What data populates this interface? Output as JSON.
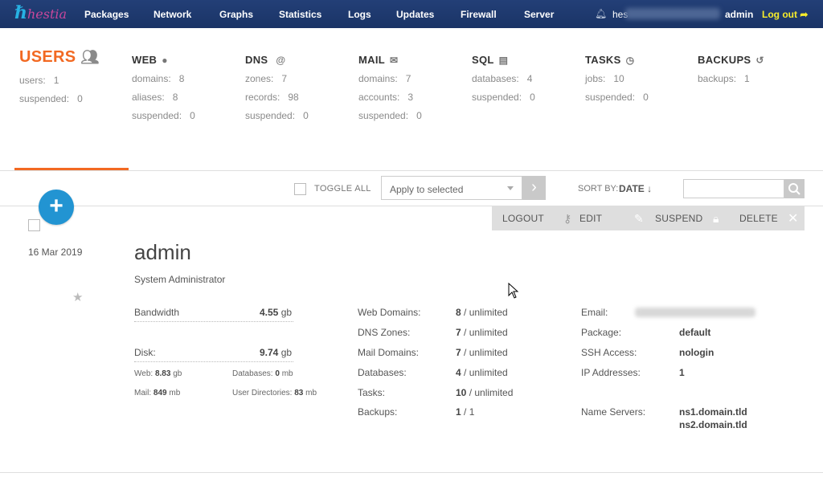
{
  "nav": {
    "logo": "hestia",
    "items": [
      "Packages",
      "Network",
      "Graphs",
      "Statistics",
      "Logs",
      "Updates",
      "Firewall",
      "Server"
    ],
    "user_prefix": "hes",
    "admin": "admin",
    "logout": "Log out"
  },
  "stats": {
    "users": {
      "title": "USERS",
      "rows": [
        [
          "users:",
          "1"
        ],
        [
          "suspended:",
          "0"
        ]
      ]
    },
    "web": {
      "title": "WEB",
      "rows": [
        [
          "domains:",
          "8"
        ],
        [
          "aliases:",
          "8"
        ],
        [
          "suspended:",
          "0"
        ]
      ]
    },
    "dns": {
      "title": "DNS",
      "rows": [
        [
          "zones:",
          "7"
        ],
        [
          "records:",
          "98"
        ],
        [
          "suspended:",
          "0"
        ]
      ]
    },
    "mail": {
      "title": "MAIL",
      "rows": [
        [
          "domains:",
          "7"
        ],
        [
          "accounts:",
          "3"
        ],
        [
          "suspended:",
          "0"
        ]
      ]
    },
    "sql": {
      "title": "SQL",
      "rows": [
        [
          "databases:",
          "4"
        ],
        [
          "suspended:",
          "0"
        ]
      ]
    },
    "tasks": {
      "title": "TASKS",
      "rows": [
        [
          "jobs:",
          "10"
        ],
        [
          "suspended:",
          "0"
        ]
      ]
    },
    "backups": {
      "title": "BACKUPS",
      "rows": [
        [
          "backups:",
          "1"
        ]
      ]
    }
  },
  "toolbar": {
    "toggle_all": "TOGGLE ALL",
    "apply_selected": "Apply to selected",
    "sort_by": "SORT BY:",
    "sort_value": "DATE ↓",
    "search_placeholder": ""
  },
  "actions": {
    "logout": "LOGOUT",
    "edit": "EDIT",
    "suspend": "SUSPEND",
    "delete": "DELETE"
  },
  "user": {
    "date": "16  Mar  2019",
    "name": "admin",
    "fullname": "System Administrator",
    "bandwidth_label": "Bandwidth",
    "bandwidth_value": "4.55",
    "bandwidth_unit": "gb",
    "disk_label": "Disk:",
    "disk_value": "9.74",
    "disk_unit": "gb",
    "web_label": "Web:",
    "web_value": "8.83",
    "web_unit": "gb",
    "databases_label": "Databases:",
    "databases_value": "0",
    "databases_unit": "mb",
    "mail_label": "Mail:",
    "mail_value": "849",
    "mail_unit": "mb",
    "userdirs_label": "User Directories:",
    "userdirs_value": "83",
    "userdirs_unit": "mb",
    "limits": [
      {
        "label": "Web Domains:",
        "used": "8",
        "limit": "/ unlimited"
      },
      {
        "label": "DNS Zones:",
        "used": "7",
        "limit": "/ unlimited"
      },
      {
        "label": "Mail Domains:",
        "used": "7",
        "limit": "/ unlimited"
      },
      {
        "label": "Databases:",
        "used": "4",
        "limit": "/ unlimited"
      },
      {
        "label": "Tasks:",
        "used": "10",
        "limit": "/ unlimited"
      },
      {
        "label": "Backups:",
        "used": "1",
        "limit": "/ 1"
      }
    ],
    "email_label": "Email:",
    "package_label": "Package:",
    "package_value": "default",
    "ssh_label": "SSH Access:",
    "ssh_value": "nologin",
    "ip_label": "IP Addresses:",
    "ip_value": "1",
    "ns_label": "Name Servers:",
    "ns1": "ns1.domain.tld",
    "ns2": "ns2.domain.tld"
  },
  "icons": {
    "bell": "bell-icon",
    "logout": "logout-arrow-icon",
    "users": "users-group-icon",
    "web": "globe-icon",
    "dns": "at-icon",
    "mail": "mail-icon",
    "sql": "database-icon",
    "tasks": "clock-icon",
    "backups": "restore-icon"
  },
  "colors": {
    "nav_bg": "#1d3a6e",
    "accent": "#f26922",
    "add_button": "#2294d2",
    "logout": "#f6ec2b"
  }
}
